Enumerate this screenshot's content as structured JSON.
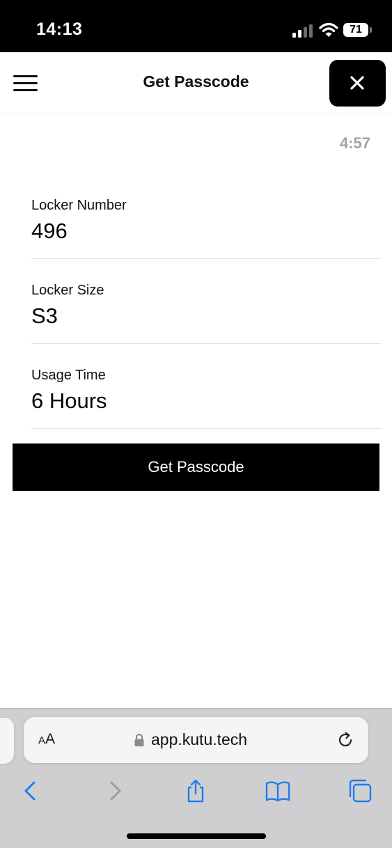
{
  "status_bar": {
    "time": "14:13",
    "battery_level": "71"
  },
  "header": {
    "title": "Get Passcode",
    "menu_icon": "hamburger-menu-icon",
    "close_icon": "close-icon"
  },
  "countdown": "4:57",
  "details": [
    {
      "label": "Locker Number",
      "value": "496"
    },
    {
      "label": "Locker Size",
      "value": "S3"
    },
    {
      "label": "Usage Time",
      "value": "6 Hours"
    }
  ],
  "primary_button": {
    "label": "Get Passcode"
  },
  "browser": {
    "text_size_label_small": "A",
    "text_size_label_large": "A",
    "url": "app.kutu.tech",
    "icons": [
      "back-icon",
      "forward-icon",
      "share-icon",
      "bookmarks-icon",
      "tabs-icon"
    ]
  },
  "colors": {
    "accent": "#000000",
    "muted_text": "#a3a3a3",
    "browser_blue": "#1f7cf0"
  }
}
